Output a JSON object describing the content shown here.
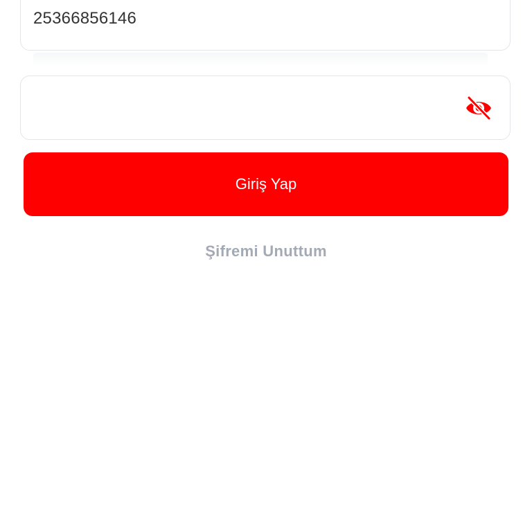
{
  "login_form": {
    "username_value": "25366856146",
    "password_value": "",
    "password_toggle_icon": "eye-off-icon",
    "submit_label": "Giriş Yap",
    "forgot_password_label": "Şifremi Unuttum"
  },
  "colors": {
    "accent": "#ff0000",
    "button_text": "#ffffff",
    "link_text": "#a3aab5",
    "field_border": "#e3e5e8",
    "input_text": "#333333"
  }
}
